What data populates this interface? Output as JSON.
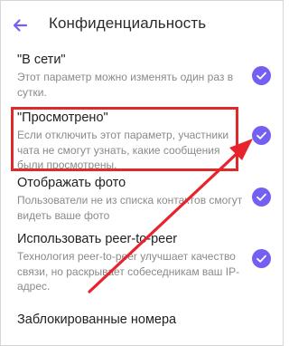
{
  "header": {
    "title": "Конфиденциальность",
    "back_icon": "arrow-left-icon"
  },
  "colors": {
    "accent": "#7360f2",
    "highlight": "#e02a2a",
    "arrow": "#e8232d"
  },
  "settings": [
    {
      "title": "\"В сети\"",
      "description": "Этот параметр можно изменять один раз в сутки.",
      "checked": true
    },
    {
      "title": "\"Просмотрено\"",
      "description": "Если отключить этот параметр, участники чата не смогут узнать, какие сообщения были просмотрены.",
      "checked": true
    },
    {
      "title": "Отображать фото",
      "description": "Пользователи не из списка контактов смогут видеть ваше фото",
      "checked": true
    },
    {
      "title": "Использовать peer-to-peer",
      "description": "Технология peer-to-peer улучшает качество связи, но раскрывает собеседникам ваш IP-адрес.",
      "checked": true
    }
  ],
  "blocked_numbers": {
    "label": "Заблокированные номера"
  }
}
